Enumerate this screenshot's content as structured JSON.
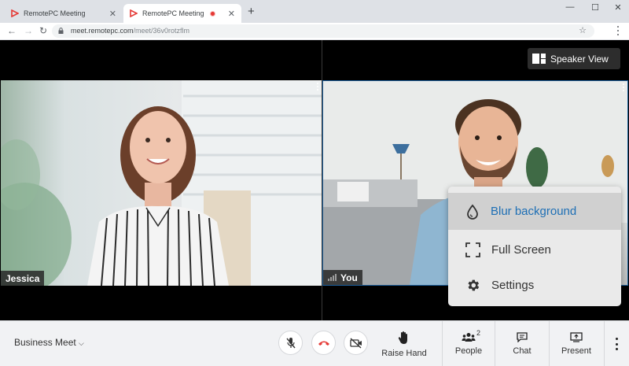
{
  "browser": {
    "tabs": [
      {
        "title": "RemotePC Meeting",
        "active": false
      },
      {
        "title": "RemotePC Meeting",
        "active": true,
        "recording": true
      }
    ],
    "url_host": "meet.remotepc.com",
    "url_path": "/meet/36v0rotzflm",
    "window_controls": [
      "minimize",
      "maximize",
      "close"
    ]
  },
  "stage": {
    "speaker_view_label": "Speaker View",
    "participants": [
      {
        "name": "Jessica",
        "is_self": false
      },
      {
        "name": "You",
        "is_self": true
      }
    ]
  },
  "context_menu": {
    "items": [
      {
        "label": "Blur background",
        "icon": "droplet-icon",
        "selected": true
      },
      {
        "label": "Full Screen",
        "icon": "fullscreen-icon",
        "selected": false
      },
      {
        "label": "Settings",
        "icon": "gear-icon",
        "selected": false
      }
    ]
  },
  "controls": {
    "meeting_name": "Business Meet",
    "raise_hand_label": "Raise Hand",
    "people_label": "People",
    "people_count": "2",
    "chat_label": "Chat",
    "present_label": "Present"
  },
  "colors": {
    "accent_blue": "#1e6fb5",
    "hangup_red": "#e53935",
    "stage_bg": "#000000",
    "control_bar_bg": "#f1f2f4"
  }
}
